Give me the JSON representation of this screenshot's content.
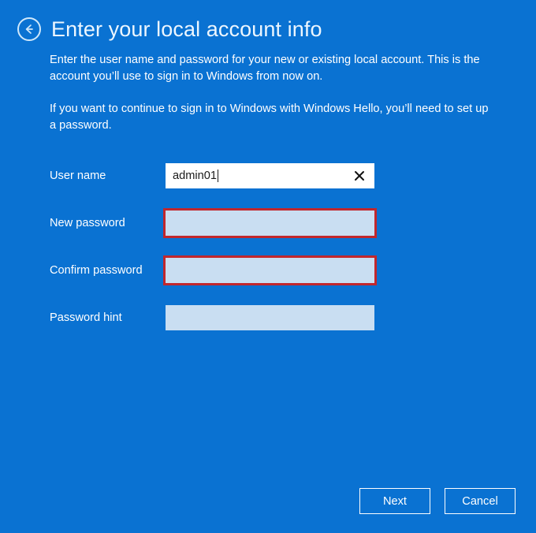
{
  "page": {
    "title": "Enter your local account info",
    "background_color": "#0a72d2",
    "description_1": "Enter the user name and password for your new or existing local account. This is the account you’ll use to sign in to Windows from now on.",
    "description_2": "If you want to continue to sign in to Windows with Windows Hello, you’ll need to set up a password."
  },
  "navigation": {
    "back_icon": "back-arrow-icon"
  },
  "form": {
    "fields": [
      {
        "label": "User name",
        "value": "admin01",
        "placeholder": "",
        "flagged": false,
        "has_clear_button": true,
        "focused": true
      },
      {
        "label": "New password",
        "value": "",
        "placeholder": "",
        "flagged": true,
        "has_clear_button": false,
        "focused": false
      },
      {
        "label": "Confirm password",
        "value": "",
        "placeholder": "",
        "flagged": true,
        "has_clear_button": false,
        "focused": false
      },
      {
        "label": "Password hint",
        "value": "",
        "placeholder": "",
        "flagged": false,
        "has_clear_button": false,
        "focused": false
      }
    ],
    "highlight_color": "#c1272d",
    "field_fill_color": "#c9def2",
    "active_field_fill_color": "#ffffff"
  },
  "footer": {
    "next_label": "Next",
    "cancel_label": "Cancel"
  }
}
